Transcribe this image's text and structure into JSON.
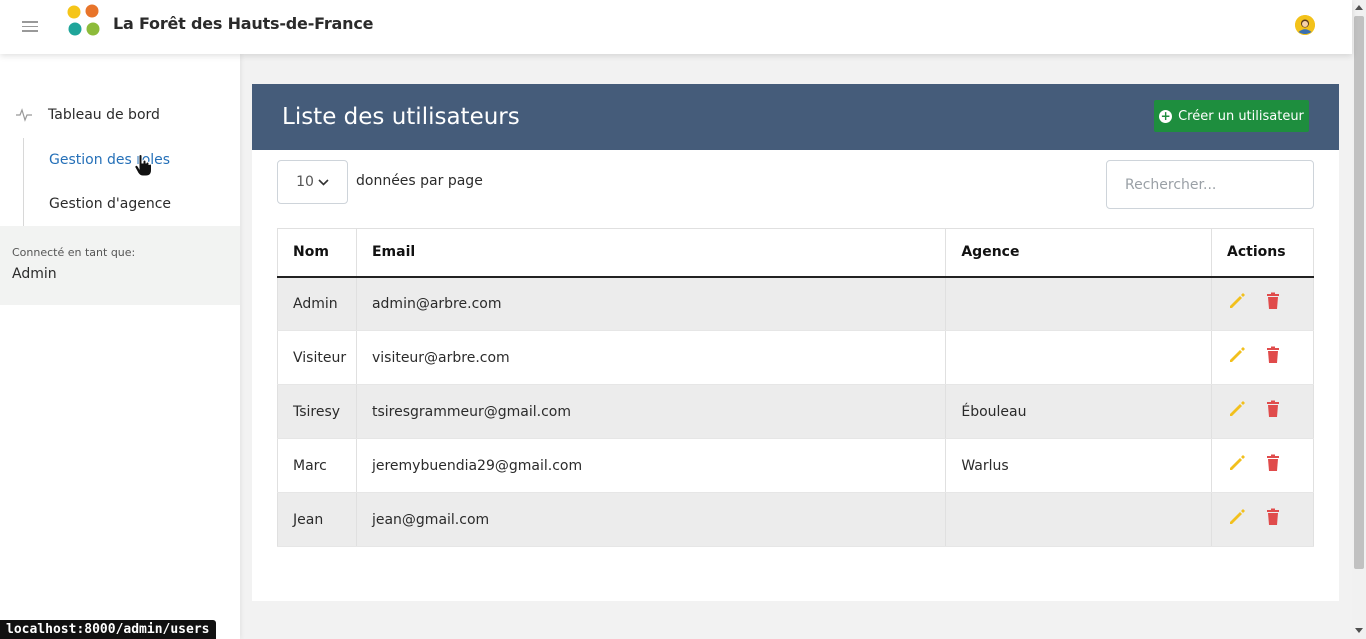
{
  "app": {
    "title": "La Forêt des Hauts-de-France"
  },
  "sidebar": {
    "items": [
      {
        "label": "Tableau de bord"
      },
      {
        "label": "Gestion des roles"
      },
      {
        "label": "Gestion d'agence"
      }
    ],
    "connected_label": "Connecté en tant que:",
    "connected_user": "Admin"
  },
  "main": {
    "title": "Liste des utilisateurs",
    "create_button": "Créer un utilisateur",
    "per_page_value": "10",
    "per_page_label": "données par page",
    "search_placeholder": "Rechercher...",
    "table": {
      "headers": [
        "Nom",
        "Email",
        "Agence",
        "Actions"
      ],
      "rows": [
        {
          "nom": "Admin",
          "email": "admin@arbre.com",
          "agence": ""
        },
        {
          "nom": "Visiteur",
          "email": "visiteur@arbre.com",
          "agence": ""
        },
        {
          "nom": "Tsiresy",
          "email": "tsiresgrammeur@gmail.com",
          "agence": "Ébouleau"
        },
        {
          "nom": "Marc",
          "email": "jeremybuendia29@gmail.com",
          "agence": "Warlus"
        },
        {
          "nom": "Jean",
          "email": "jean@gmail.com",
          "agence": ""
        }
      ]
    }
  },
  "status_url": "localhost:8000/admin/users",
  "colors": {
    "header_bar": "#455c7a",
    "create_button": "#1e8e3e",
    "edit_icon": "#f2c01d",
    "delete_icon": "#e04b4b",
    "active_link": "#2570b8"
  },
  "icons": [
    "menu-icon",
    "logo",
    "avatar-icon",
    "activity-icon",
    "plus-circle-icon",
    "chevron-down-icon",
    "pencil-icon",
    "trash-icon"
  ]
}
